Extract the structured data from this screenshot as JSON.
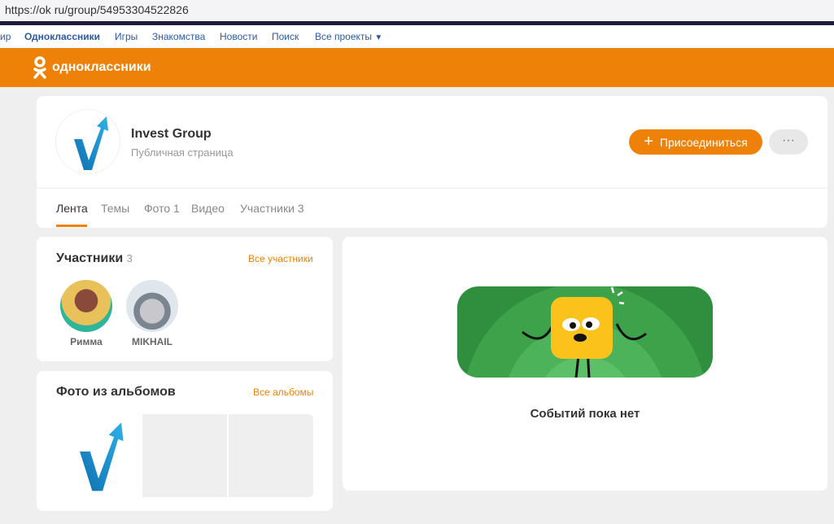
{
  "browser": {
    "url": "https://ok ru/group/54953304522826"
  },
  "topnav": {
    "items": [
      "ир",
      "Одноклассники",
      "Игры",
      "Знакомства",
      "Новости",
      "Поиск",
      "Все проекты"
    ]
  },
  "header": {
    "logo_text": "одноклассники"
  },
  "group": {
    "name": "Invest Group",
    "type": "Публичная страница",
    "join_label": "Присоединиться",
    "more_label": "···"
  },
  "tabs": [
    "Лента",
    "Темы",
    "Фото 1",
    "Видео",
    "Участники 3"
  ],
  "members": {
    "title": "Участники",
    "count": "3",
    "all_link": "Все участники",
    "list": [
      {
        "name": "Римма"
      },
      {
        "name": "MIKHAIL"
      }
    ]
  },
  "photos": {
    "title": "Фото из альбомов",
    "all_link": "Все альбомы"
  },
  "feed": {
    "empty_text": "Событий пока нет"
  },
  "colors": {
    "accent": "#ee8208",
    "link": "#2a5aa6"
  }
}
